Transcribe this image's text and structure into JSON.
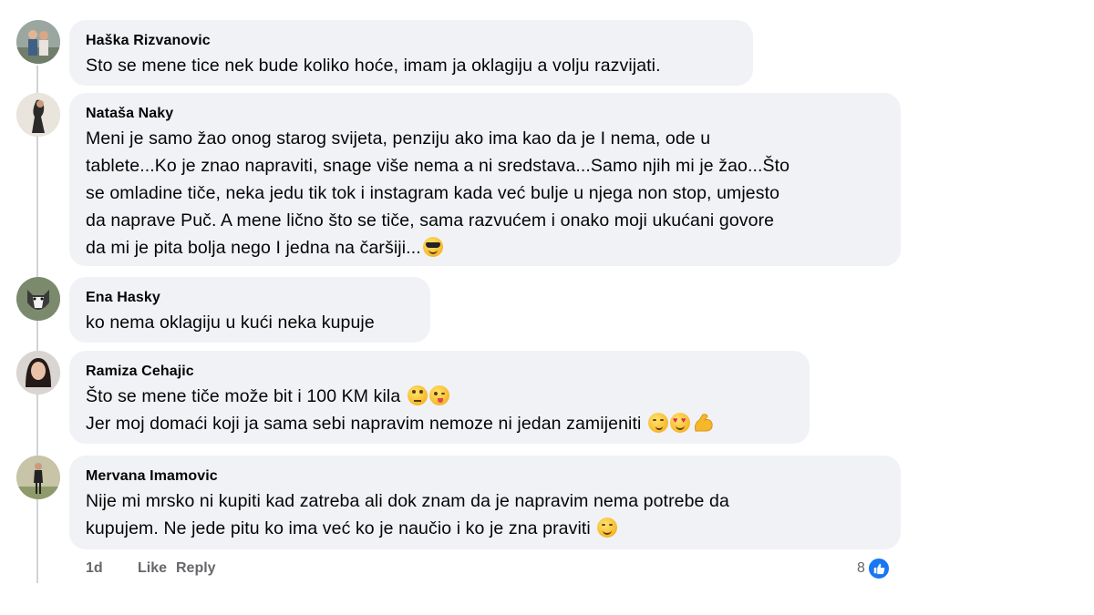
{
  "comments": [
    {
      "author": "Haška Rizvanovic",
      "lines": [
        "Sto se mene tice nek bude koliko hoće, imam ja oklagiju a volju razvijati."
      ],
      "avatar_icon": "couple-photo-avatar"
    },
    {
      "author": "Nataša Naky",
      "lines": [
        "Meni je samo žao onog starog svijeta, penziju ako ima kao da je I nema, ode u",
        "tablete...Ko je znao napraviti, snage više nema a ni sredstava...Samo njih mi je žao...Što",
        "se omladine tiče, neka jedu tik tok i instagram kada već bulje u njega non stop, umjesto",
        "da naprave Puč. A mene lično što se tiče, sama razvućem i onako moji ukućani govore",
        "da mi je pita bolja nego I jedna na čaršiji..."
      ],
      "emojis_last_line": [
        "sunglasses-face-emoji"
      ],
      "avatar_icon": "person-photo-avatar"
    },
    {
      "author": "Ena Hasky",
      "lines": [
        "ko nema oklagiju u kući neka kupuje"
      ],
      "avatar_icon": "husky-photo-avatar"
    },
    {
      "author": "Ramiza Cehajic",
      "lines": [
        "Što se mene tiče može bit i 100 KM kila",
        "Jer moj domaći koji ja sama sebi napravim nemoze ni jedan zamijeniti"
      ],
      "emojis_line1": [
        "rolling-eyes-emoji",
        "winking-tongue-emoji"
      ],
      "emojis_line2": [
        "smirk-emoji",
        "heart-eyes-emoji",
        "flexed-biceps-emoji"
      ],
      "avatar_icon": "woman-photo-avatar"
    },
    {
      "author": "Mervana Imamovic",
      "lines": [
        "Nije mi mrsko ni kupiti kad zatreba ali dok znam da je napravim nema potrebe da",
        "kupujem. Ne jede pitu ko ima već ko je naučio i ko je zna praviti"
      ],
      "emojis_last_line": [
        "smiling-face-emoji"
      ],
      "avatar_icon": "standing-person-avatar"
    }
  ],
  "footer": {
    "time": "1d",
    "like_label": "Like",
    "reply_label": "Reply",
    "reaction_count": "8",
    "reaction_icon": "thumbs-up-icon"
  },
  "colors": {
    "bubble": "#f0f2f5",
    "muted_text": "#65676b",
    "accent": "#1877f2",
    "thread_line": "#d0d3d8"
  }
}
